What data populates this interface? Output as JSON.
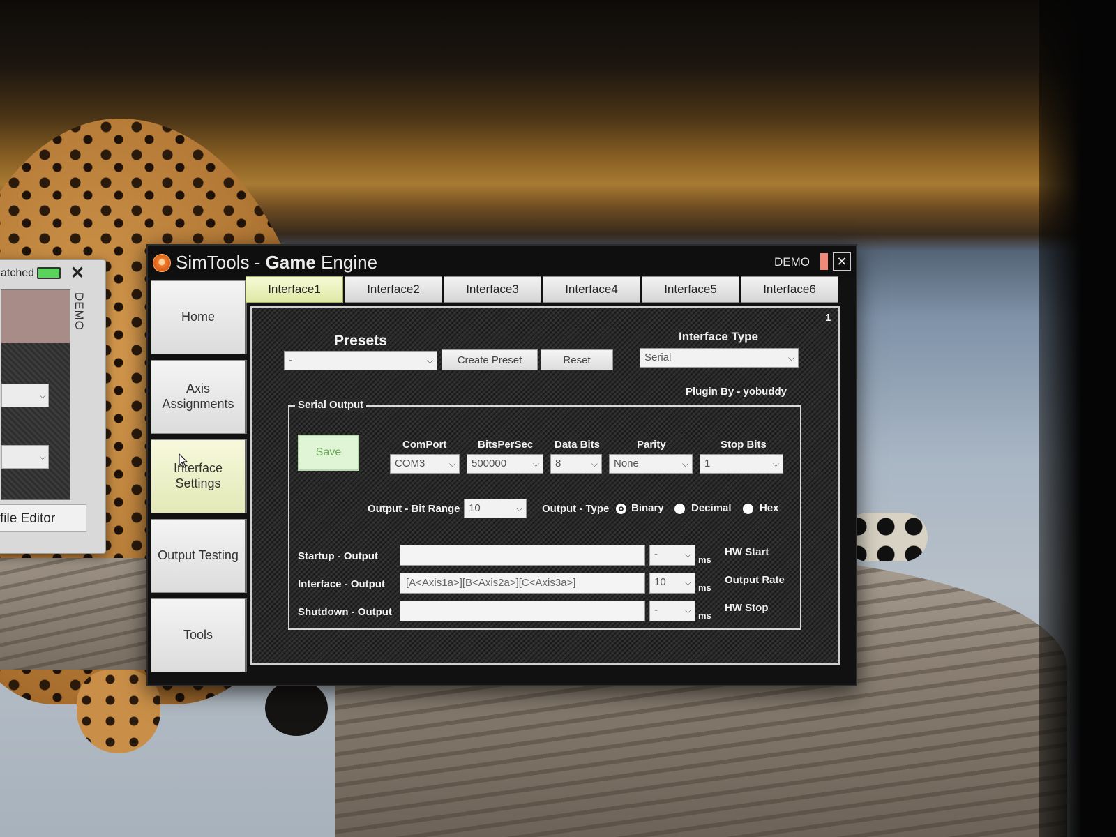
{
  "background_window": {
    "title_partial": "atched",
    "vertical_label": "DEMO",
    "close_glyph": "✕",
    "button_label": "file Editor",
    "accent_led": "#5bd45b"
  },
  "window": {
    "title_prefix": "SimTools - ",
    "title_bold": "Game",
    "title_suffix": " Engine",
    "demo_label": "DEMO",
    "close_glyph": "✕",
    "demo_color": "#f08a78"
  },
  "sidebar": {
    "items": [
      {
        "label": "Home"
      },
      {
        "label": "Axis Assignments"
      },
      {
        "label": "Interface Settings",
        "active": true
      },
      {
        "label": "Output Testing"
      },
      {
        "label": "Tools"
      }
    ]
  },
  "tabs": [
    {
      "label": "Interface1",
      "active": true
    },
    {
      "label": "Interface2"
    },
    {
      "label": "Interface3"
    },
    {
      "label": "Interface4"
    },
    {
      "label": "Interface5"
    },
    {
      "label": "Interface6"
    }
  ],
  "panel": {
    "number": "1",
    "presets": {
      "label": "Presets",
      "selected": "-",
      "create_label": "Create Preset",
      "reset_label": "Reset"
    },
    "interface_type": {
      "label": "Interface Type",
      "selected": "Serial"
    },
    "plugin_by": "Plugin By - yobuddy",
    "serial_output": {
      "group_label": "Serial Output",
      "save_label": "Save",
      "comport": {
        "label": "ComPort",
        "value": "COM3"
      },
      "bits_per_sec": {
        "label": "BitsPerSec",
        "value": "500000"
      },
      "data_bits": {
        "label": "Data Bits",
        "value": "8"
      },
      "parity": {
        "label": "Parity",
        "value": "None"
      },
      "stop_bits": {
        "label": "Stop Bits",
        "value": "1"
      },
      "bit_range": {
        "label": "Output - Bit Range",
        "value": "10"
      },
      "output_type": {
        "label": "Output - Type",
        "options": [
          "Binary",
          "Decimal",
          "Hex"
        ],
        "selected": "Binary"
      },
      "rows": [
        {
          "label": "Startup - Output",
          "value": "",
          "ms_value": "-",
          "unit": "ms",
          "right_label": "HW Start"
        },
        {
          "label": "Interface - Output",
          "value": "[A<Axis1a>][B<Axis2a>][C<Axis3a>]",
          "ms_value": "10",
          "unit": "ms",
          "right_label": "Output Rate"
        },
        {
          "label": "Shutdown - Output",
          "value": "",
          "ms_value": "-",
          "unit": "ms",
          "right_label": "HW Stop"
        }
      ]
    }
  }
}
